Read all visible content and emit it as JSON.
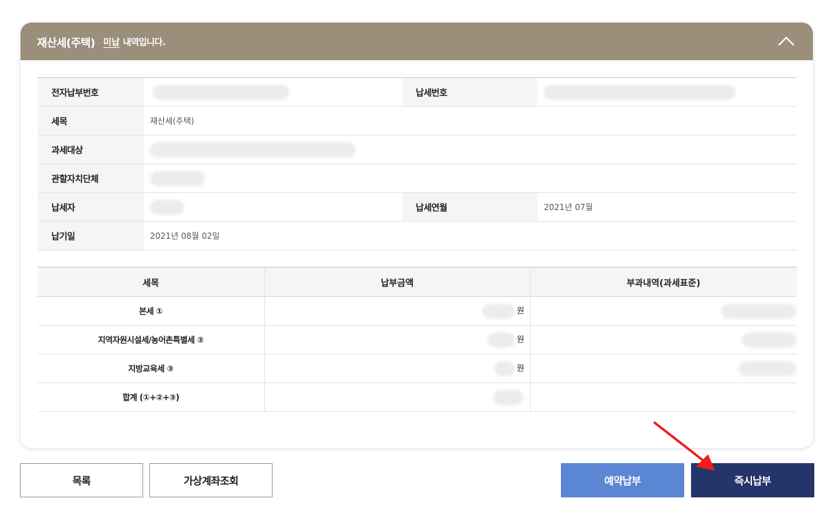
{
  "header": {
    "title": "재산세(주택)",
    "status": "미납",
    "suffix": "내역입니다."
  },
  "info": {
    "electronic_payment_no_label": "전자납부번호",
    "electronic_payment_no_value": "",
    "tax_no_label": "납세번호",
    "tax_no_value": "",
    "tax_item_label": "세목",
    "tax_item_value": "재산세(주택)",
    "tax_object_label": "과세대상",
    "tax_object_value": "",
    "local_gov_label": "관할자치단체",
    "local_gov_value": "",
    "taxpayer_label": "납세자",
    "taxpayer_value": "",
    "tax_month_label": "납세연월",
    "tax_month_value": "2021년 07월",
    "due_date_label": "납기일",
    "due_date_value": "2021년 08월 02일"
  },
  "payment_table": {
    "headers": [
      "세목",
      "납부금액",
      "부과내역(과세표준)"
    ],
    "rows": [
      {
        "item": "본세 ①",
        "unit": "원"
      },
      {
        "item": "지역자원시설세/농어촌특별세 ②",
        "unit": "원"
      },
      {
        "item": "지방교육세 ③",
        "unit": "원"
      },
      {
        "item": "합계 (①+②+③)",
        "unit": ""
      }
    ]
  },
  "buttons": {
    "list": "목록",
    "virtual_account": "가상계좌조회",
    "reserve_pay": "예약납부",
    "instant_pay": "즉시납부"
  },
  "colors": {
    "header_bg": "#9b8e7b",
    "reserve_btn": "#5a86d4",
    "instant_btn": "#23356a",
    "annotation_arrow": "#ee1c1c"
  },
  "icons": {
    "collapse": "chevron-up-icon",
    "annotation": "red-arrow-icon"
  }
}
